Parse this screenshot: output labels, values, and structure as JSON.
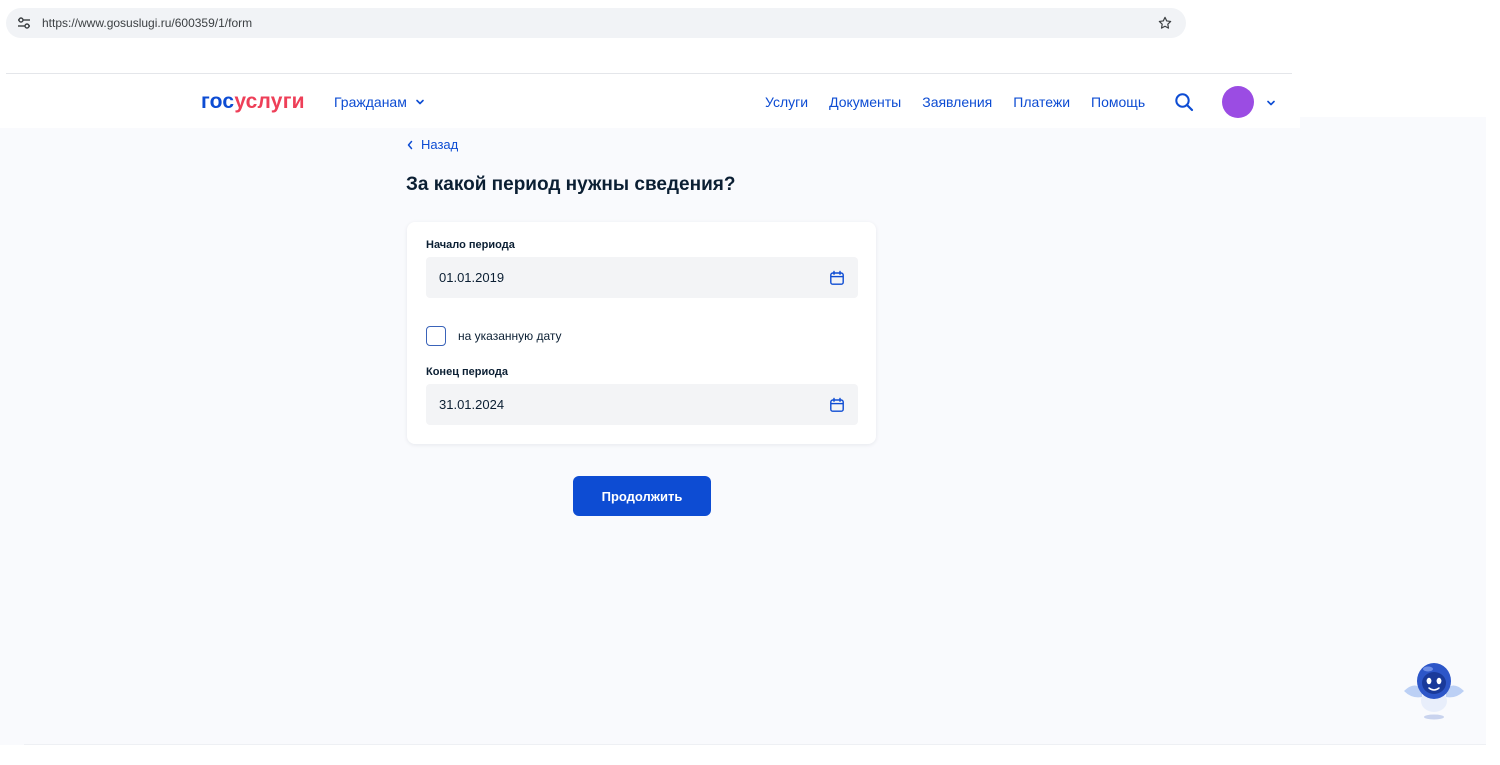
{
  "browser": {
    "url": "https://www.gosuslugi.ru/600359/1/form"
  },
  "header": {
    "logo_part1": "гос",
    "logo_part2": "услуги",
    "audience_label": "Гражданам",
    "nav": [
      {
        "label": "Услуги"
      },
      {
        "label": "Документы"
      },
      {
        "label": "Заявления"
      },
      {
        "label": "Платежи"
      },
      {
        "label": "Помощь"
      }
    ],
    "avatar_color": "#9b4ce3"
  },
  "page": {
    "back_label": "Назад",
    "title": "За какой период нужны сведения?"
  },
  "form": {
    "start_label": "Начало периода",
    "start_value": "01.01.2019",
    "checkbox_label": "на указанную дату",
    "checkbox_checked": false,
    "end_label": "Конец периода",
    "end_value": "31.01.2024"
  },
  "actions": {
    "continue_label": "Продолжить"
  },
  "colors": {
    "primary": "#0d4cd3",
    "logo_accent": "#ee3f58",
    "page_background": "#f9fafd"
  },
  "icons": {
    "site_info": "tune-icon",
    "bookmark": "star-icon",
    "search": "search-icon",
    "calendar": "calendar-icon",
    "assistant": "robot-assistant-icon"
  }
}
